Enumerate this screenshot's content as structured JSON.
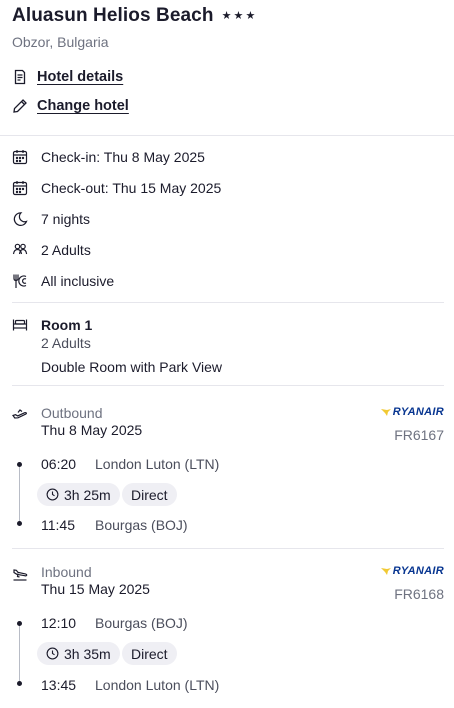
{
  "hotel": {
    "name": "Aluasun Helios Beach",
    "stars": 3,
    "location": "Obzor, Bulgaria"
  },
  "links": {
    "details": "Hotel details",
    "change": "Change hotel"
  },
  "stay": {
    "checkin": "Check-in: Thu 8 May 2025",
    "checkout": "Check-out: Thu 15 May 2025",
    "nights": "7 nights",
    "guests": "2 Adults",
    "board": "All inclusive"
  },
  "room": {
    "title": "Room 1",
    "guests": "2 Adults",
    "type": "Double Room with Park View"
  },
  "outbound": {
    "direction": "Outbound",
    "date": "Thu 8 May 2025",
    "airline": "RYANAIR",
    "flight_no": "FR6167",
    "depart_time": "06:20",
    "depart_place": "London Luton (LTN)",
    "duration": "3h 25m",
    "stops": "Direct",
    "arrive_time": "11:45",
    "arrive_place": "Bourgas (BOJ)"
  },
  "inbound": {
    "direction": "Inbound",
    "date": "Thu 15 May 2025",
    "airline": "RYANAIR",
    "flight_no": "FR6168",
    "depart_time": "12:10",
    "depart_place": "Bourgas (BOJ)",
    "duration": "3h 35m",
    "stops": "Direct",
    "arrive_time": "13:45",
    "arrive_place": "London Luton (LTN)"
  },
  "icons": {
    "stars": "star-icon",
    "details": "document-icon",
    "change": "pencil-icon",
    "checkin": "calendar-icon",
    "checkout": "calendar-icon",
    "nights": "moon-icon",
    "guests": "people-icon",
    "board": "cutlery-icon",
    "room": "bed-icon",
    "outbound": "plane-takeoff-icon",
    "inbound": "plane-landing-icon",
    "duration": "clock-icon"
  },
  "colors": {
    "text": "#1b1b2b",
    "muted": "#6e7280",
    "pill_bg": "#efeff4",
    "ryanair_blue": "#073590",
    "ryanair_yellow": "#f1c933"
  }
}
